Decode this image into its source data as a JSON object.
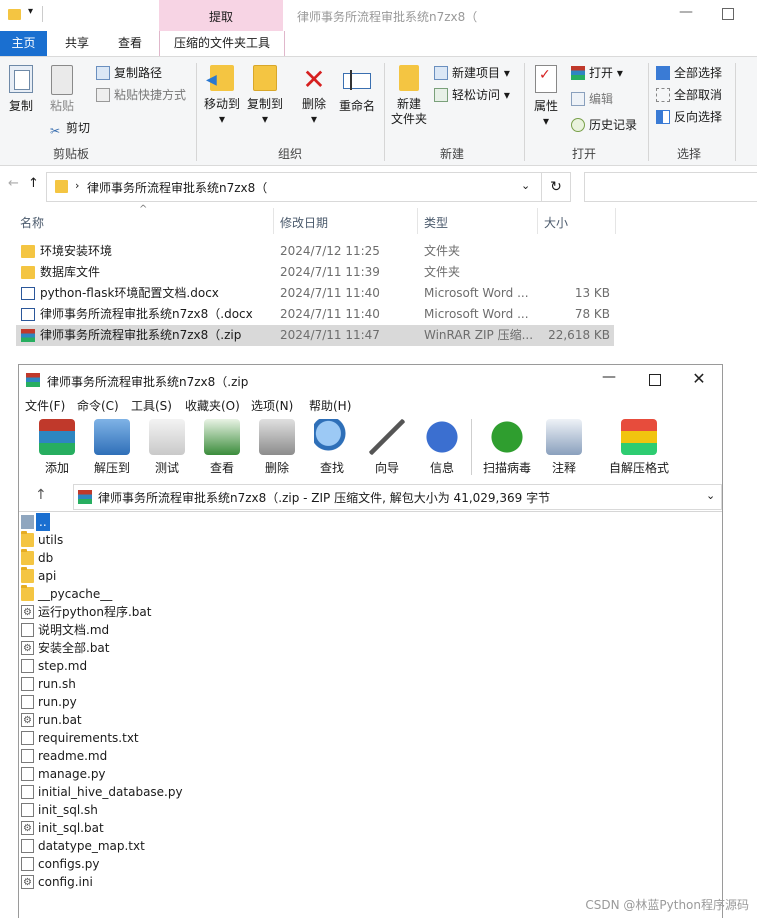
{
  "explorer": {
    "title": "律师事务所流程审批系统n7zx8（",
    "contextual_tab": "提取",
    "tabs": [
      "主页",
      "共享",
      "查看",
      "压缩的文件夹工具"
    ],
    "ribbon": {
      "clipboard": {
        "label": "剪贴板",
        "copy": "复制",
        "paste": "粘贴",
        "copy_path": "复制路径",
        "paste_shortcut": "粘贴快捷方式",
        "cut": "剪切"
      },
      "organize": {
        "label": "组织",
        "move_to": "移动到",
        "copy_to": "复制到",
        "delete": "删除",
        "rename": "重命名"
      },
      "new": {
        "label": "新建",
        "new_folder": "新建\n文件夹",
        "new_item": "新建项目",
        "easy_access": "轻松访问"
      },
      "open": {
        "label": "打开",
        "properties": "属性",
        "open": "打开",
        "edit": "编辑",
        "history": "历史记录"
      },
      "select": {
        "label": "选择",
        "select_all": "全部选择",
        "select_none": "全部取消",
        "invert": "反向选择"
      }
    },
    "address": "律师事务所流程审批系统n7zx8（",
    "columns": {
      "name": "名称",
      "date": "修改日期",
      "type": "类型",
      "size": "大小"
    },
    "files": [
      {
        "name": "环境安装环境",
        "date": "2024/7/12 11:25",
        "type": "文件夹",
        "size": "",
        "icon": "folder"
      },
      {
        "name": "数据库文件",
        "date": "2024/7/11 11:39",
        "type": "文件夹",
        "size": "",
        "icon": "folder"
      },
      {
        "name": "python-flask环境配置文档.docx",
        "date": "2024/7/11 11:40",
        "type": "Microsoft Word ...",
        "size": "13 KB",
        "icon": "word"
      },
      {
        "name": "律师事务所流程审批系统n7zx8（.docx",
        "date": "2024/7/11 11:40",
        "type": "Microsoft Word ...",
        "size": "78 KB",
        "icon": "word"
      },
      {
        "name": "律师事务所流程审批系统n7zx8（.zip",
        "date": "2024/7/11 11:47",
        "type": "WinRAR ZIP 压缩...",
        "size": "22,618 KB",
        "icon": "winrar",
        "selected": true
      }
    ]
  },
  "winrar": {
    "title": "律师事务所流程审批系统n7zx8（.zip",
    "menu": [
      "文件(F)",
      "命令(C)",
      "工具(S)",
      "收藏夹(O)",
      "选项(N)",
      "帮助(H)"
    ],
    "tools": [
      "添加",
      "解压到",
      "测试",
      "查看",
      "删除",
      "查找",
      "向导",
      "信息",
      "扫描病毒",
      "注释",
      "自解压格式"
    ],
    "path": "律师事务所流程审批系统n7zx8（.zip - ZIP 压缩文件, 解包大小为 41,029,369 字节",
    "items": [
      {
        "name": "..",
        "icon": "up"
      },
      {
        "name": "utils",
        "icon": "folder"
      },
      {
        "name": "db",
        "icon": "folder"
      },
      {
        "name": "api",
        "icon": "folder"
      },
      {
        "name": "__pycache__",
        "icon": "folder"
      },
      {
        "name": "运行python程序.bat",
        "icon": "bat"
      },
      {
        "name": "说明文档.md",
        "icon": "file"
      },
      {
        "name": "安装全部.bat",
        "icon": "bat"
      },
      {
        "name": "step.md",
        "icon": "file"
      },
      {
        "name": "run.sh",
        "icon": "file"
      },
      {
        "name": "run.py",
        "icon": "file"
      },
      {
        "name": "run.bat",
        "icon": "bat"
      },
      {
        "name": "requirements.txt",
        "icon": "file"
      },
      {
        "name": "readme.md",
        "icon": "file"
      },
      {
        "name": "manage.py",
        "icon": "file"
      },
      {
        "name": "initial_hive_database.py",
        "icon": "file"
      },
      {
        "name": "init_sql.sh",
        "icon": "file"
      },
      {
        "name": "init_sql.bat",
        "icon": "bat"
      },
      {
        "name": "datatype_map.txt",
        "icon": "file"
      },
      {
        "name": "configs.py",
        "icon": "file"
      },
      {
        "name": "config.ini",
        "icon": "config"
      }
    ]
  },
  "watermark": "CSDN @林蓝Python程序源码"
}
